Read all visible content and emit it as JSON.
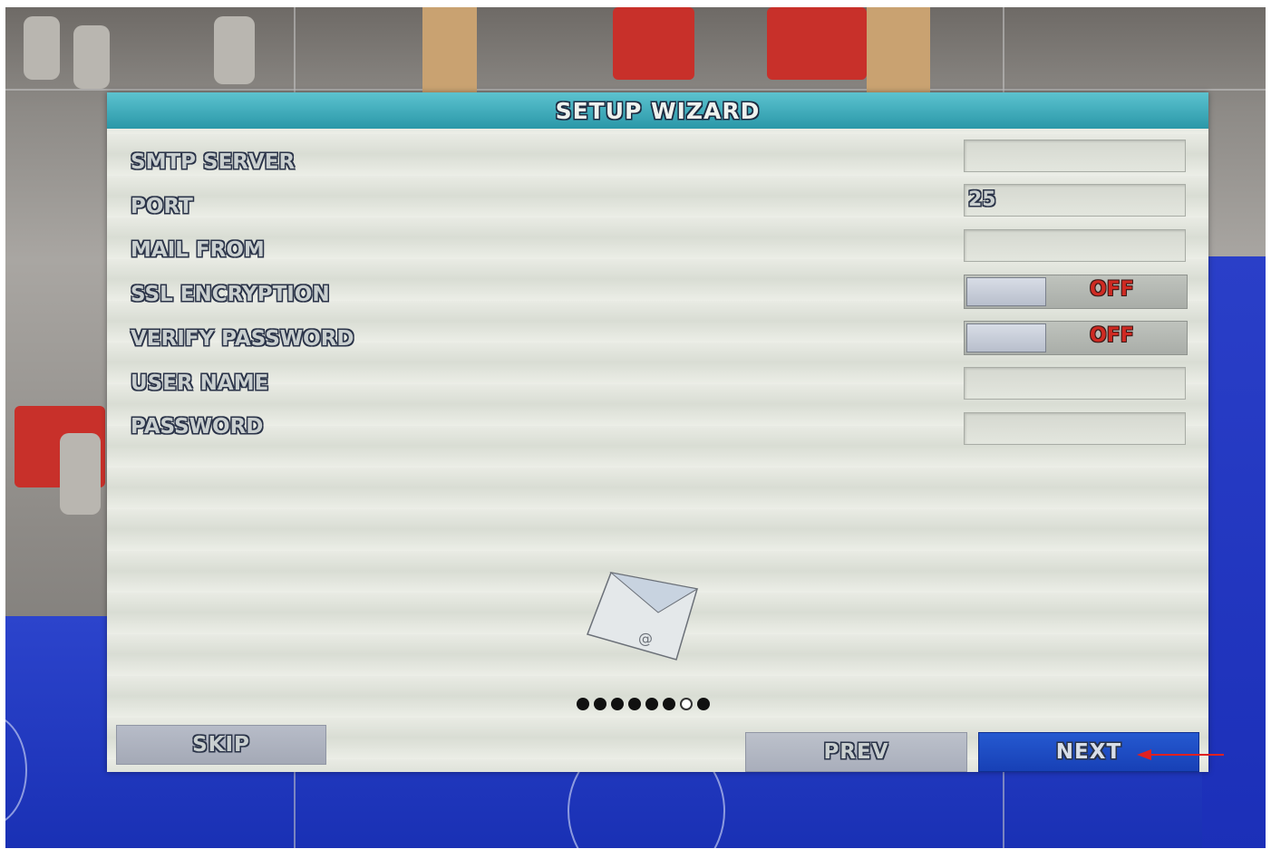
{
  "dialog": {
    "title": "SETUP WIZARD"
  },
  "fields": [
    {
      "label": "SMTP SERVER",
      "value": ""
    },
    {
      "label": "PORT",
      "value": "25"
    },
    {
      "label": "MAIL FROM",
      "value": ""
    },
    {
      "label": "SSL ENCRYPTION",
      "toggle": "OFF"
    },
    {
      "label": "VERIFY PASSWORD",
      "toggle": "OFF"
    },
    {
      "label": "USER NAME",
      "value": ""
    },
    {
      "label": "PASSWORD",
      "value": ""
    }
  ],
  "envelope_symbol": "@",
  "progress": {
    "total_steps": 8,
    "current_step": 7
  },
  "buttons": {
    "skip": "SKIP",
    "prev": "PREV",
    "next": "NEXT"
  },
  "colors": {
    "title_bar": "#2a97a8",
    "next_button": "#1740b6",
    "toggle_off": "#cf2a22",
    "annotation_arrow": "#e02020"
  }
}
